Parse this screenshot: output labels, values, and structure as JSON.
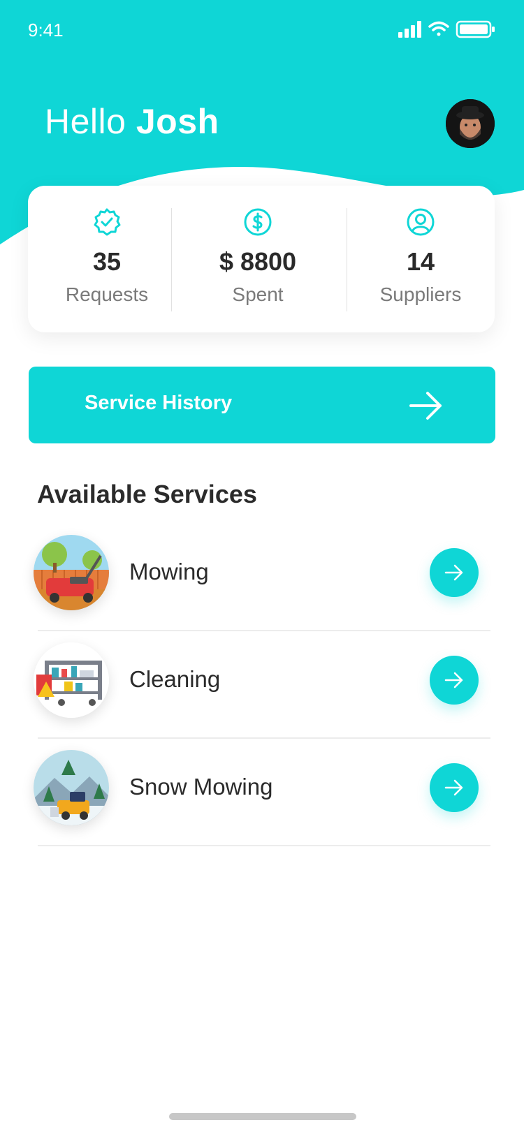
{
  "status_bar": {
    "time": "9:41",
    "icons": [
      "signal-icon",
      "wifi-icon",
      "battery-icon"
    ]
  },
  "header": {
    "greeting_prefix": "Hello",
    "user_name": "Josh"
  },
  "stats": [
    {
      "icon": "check-badge-icon",
      "value": "35",
      "label": "Requests"
    },
    {
      "icon": "dollar-icon",
      "value": "$ 8800",
      "label": "Spent"
    },
    {
      "icon": "user-circle-icon",
      "value": "14",
      "label": "Suppliers"
    }
  ],
  "history_button": {
    "label": "Service History",
    "icon": "arrow-right-icon"
  },
  "services": {
    "title": "Available Services",
    "items": [
      {
        "name": "Mowing",
        "icon": "lawn-mower-icon"
      },
      {
        "name": "Cleaning",
        "icon": "cleaning-cart-icon"
      },
      {
        "name": "Snow Mowing",
        "icon": "snow-plow-icon"
      }
    ]
  },
  "colors": {
    "accent": "#0fd6d6",
    "text_dark": "#2b2b2b",
    "text_muted": "#7a7a7a"
  }
}
